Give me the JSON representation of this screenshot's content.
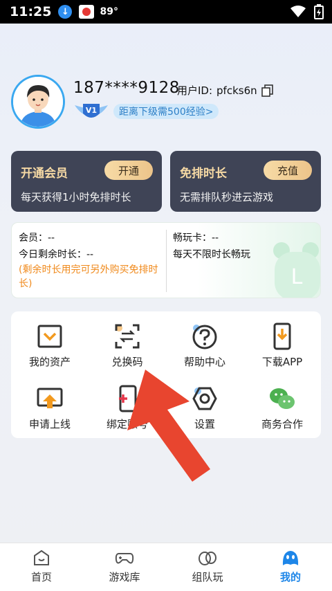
{
  "status": {
    "time": "11:25",
    "temperature": "89°"
  },
  "profile": {
    "phone": "187****9128",
    "uid_label": "用户ID:",
    "uid_value": "pfcks6n",
    "level": "V1",
    "exp_text": "距离下级需500经验>"
  },
  "cards": [
    {
      "title": "开通会员",
      "button": "开通",
      "desc": "每天获得1小时免排时长"
    },
    {
      "title": "免排时长",
      "button": "充值",
      "desc": "无需排队秒进云游戏"
    }
  ],
  "info": {
    "member": "会员：--",
    "remaining": "今日剩余时长：--",
    "note": "(剩余时长用完可另外购买免排时长)",
    "play_card": "畅玩卡：--",
    "play_desc": "每天不限时长畅玩"
  },
  "grid": [
    {
      "label": "我的资产",
      "icon": "wallet-icon"
    },
    {
      "label": "兑换码",
      "icon": "scan-exchange-icon"
    },
    {
      "label": "帮助中心",
      "icon": "help-icon"
    },
    {
      "label": "下载APP",
      "icon": "phone-download-icon"
    },
    {
      "label": "申请上线",
      "icon": "upload-screen-icon"
    },
    {
      "label": "绑定账号",
      "icon": "bind-phone-icon"
    },
    {
      "label": "设置",
      "icon": "settings-icon"
    },
    {
      "label": "商务合作",
      "icon": "wechat-icon"
    }
  ],
  "tabs": [
    {
      "label": "首页",
      "icon": "home-icon",
      "active": false
    },
    {
      "label": "游戏库",
      "icon": "gamepad-icon",
      "active": false
    },
    {
      "label": "组队玩",
      "icon": "team-icon",
      "active": false
    },
    {
      "label": "我的",
      "icon": "mine-icon",
      "active": true
    }
  ],
  "colors": {
    "accent": "#1e86e8",
    "card_bg": "#3f4456",
    "card_title": "#f6d9a4",
    "note_orange": "#f08a1c",
    "arrow_red": "#e8452f"
  }
}
